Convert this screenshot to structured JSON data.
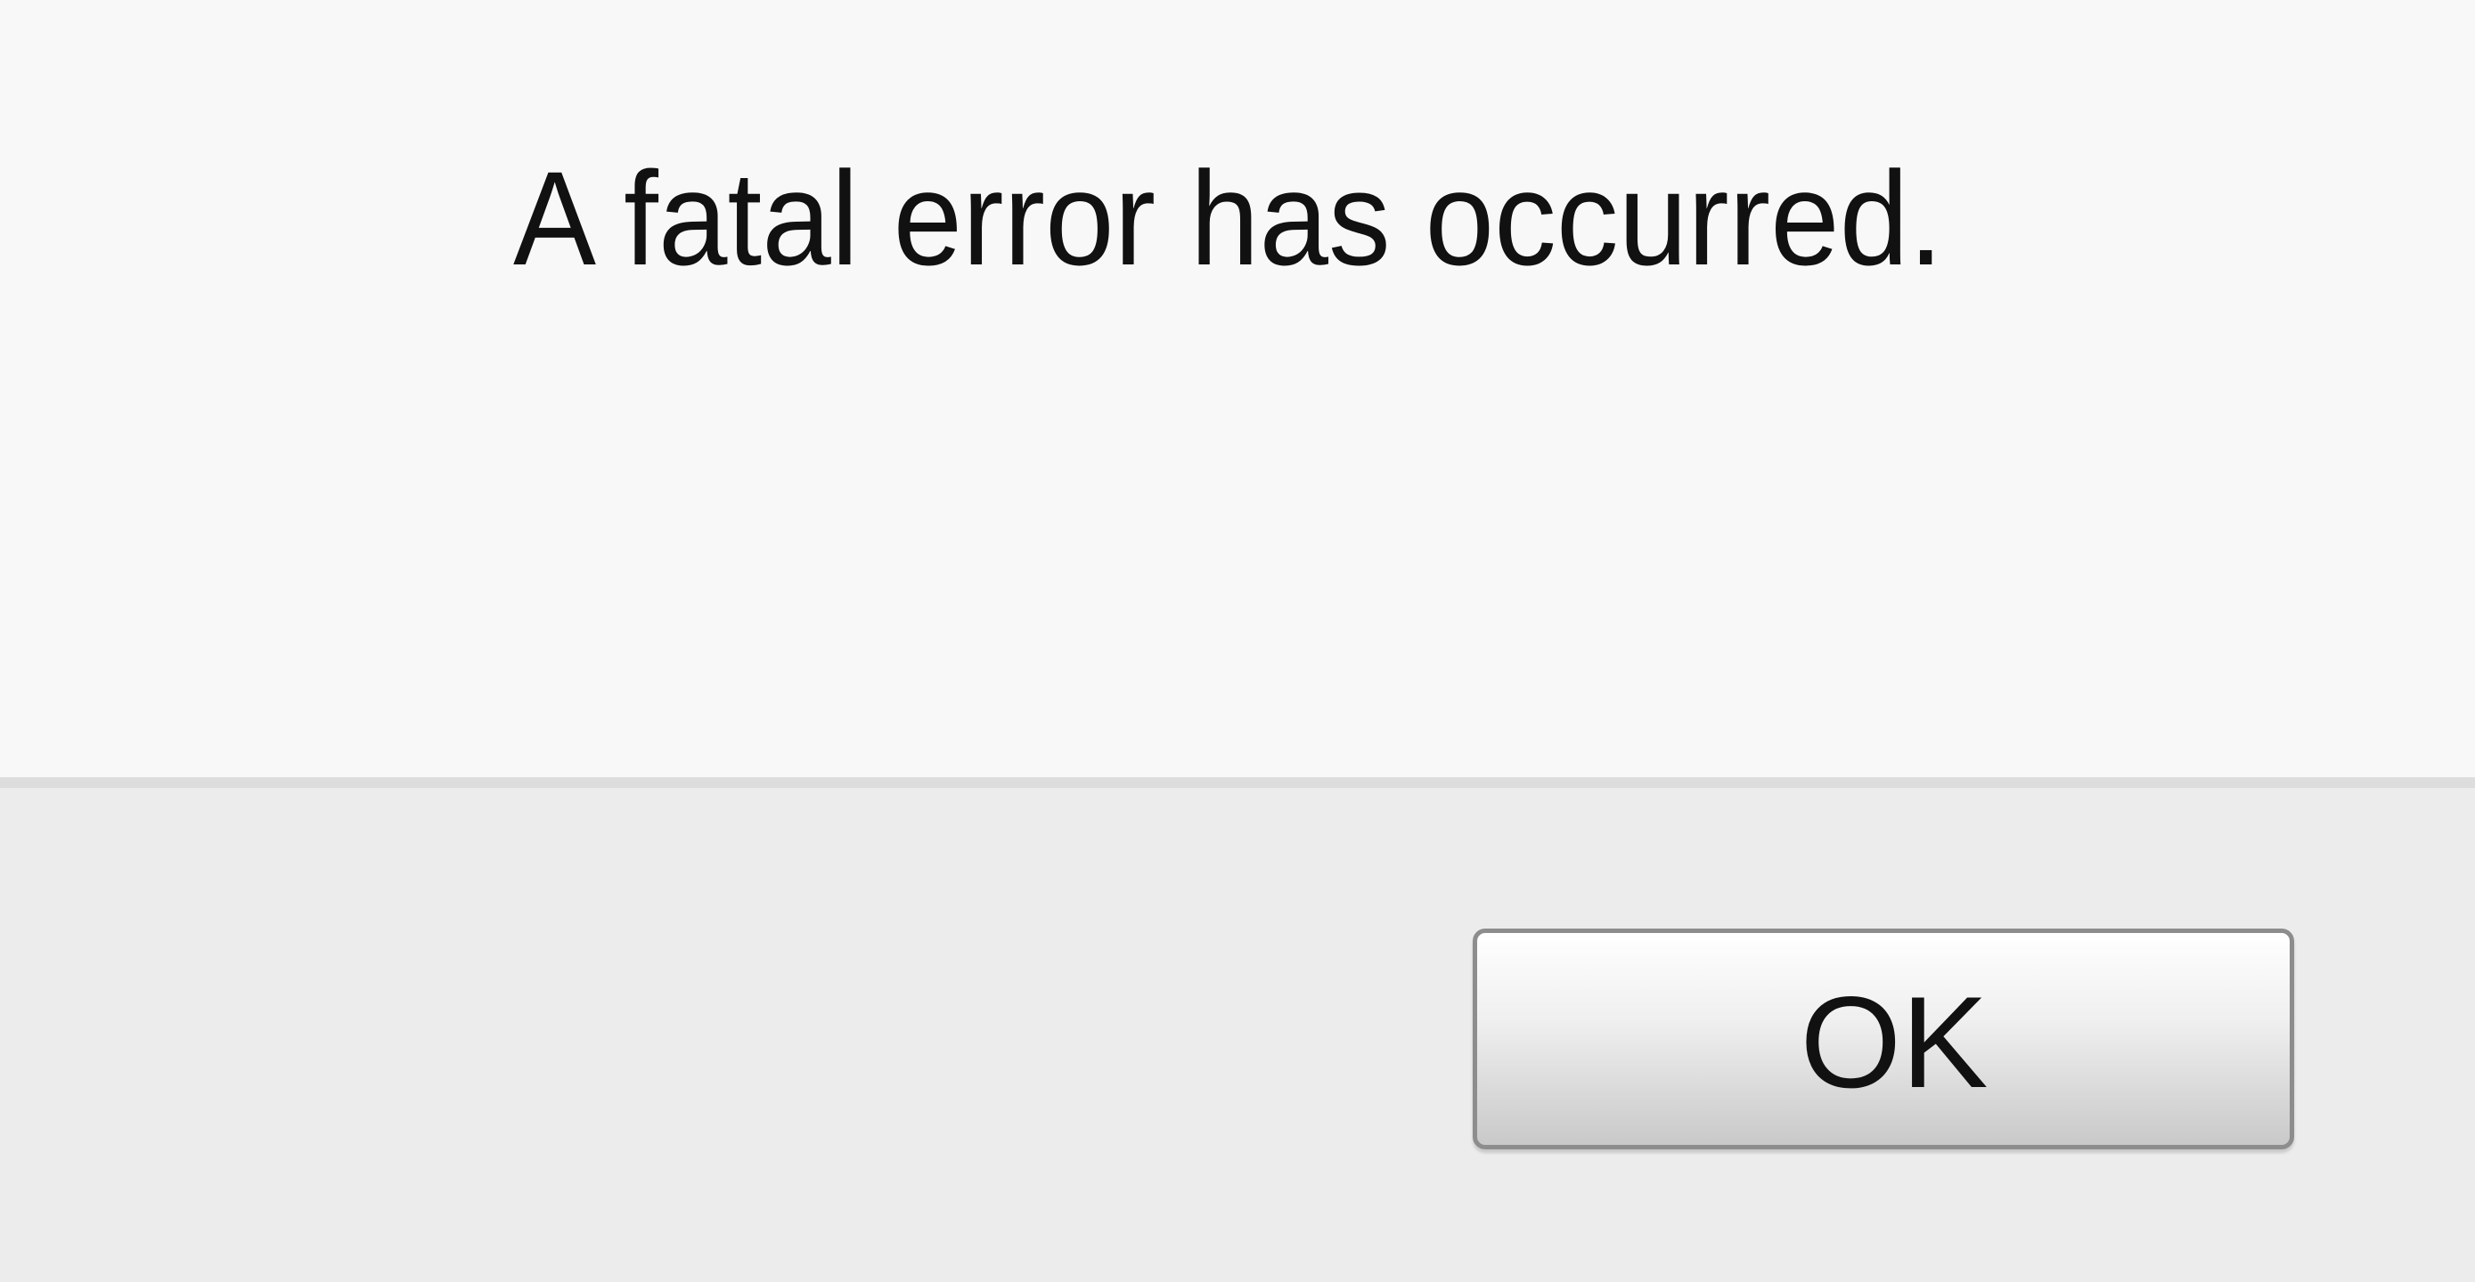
{
  "dialog": {
    "message": "A fatal error has occurred.",
    "ok_label": "OK"
  },
  "colors": {
    "message_background": "#f8f8f8",
    "button_bar_background": "#ececec",
    "divider": "#dddddd",
    "text": "#111111",
    "button_border": "#8d8d8d"
  }
}
